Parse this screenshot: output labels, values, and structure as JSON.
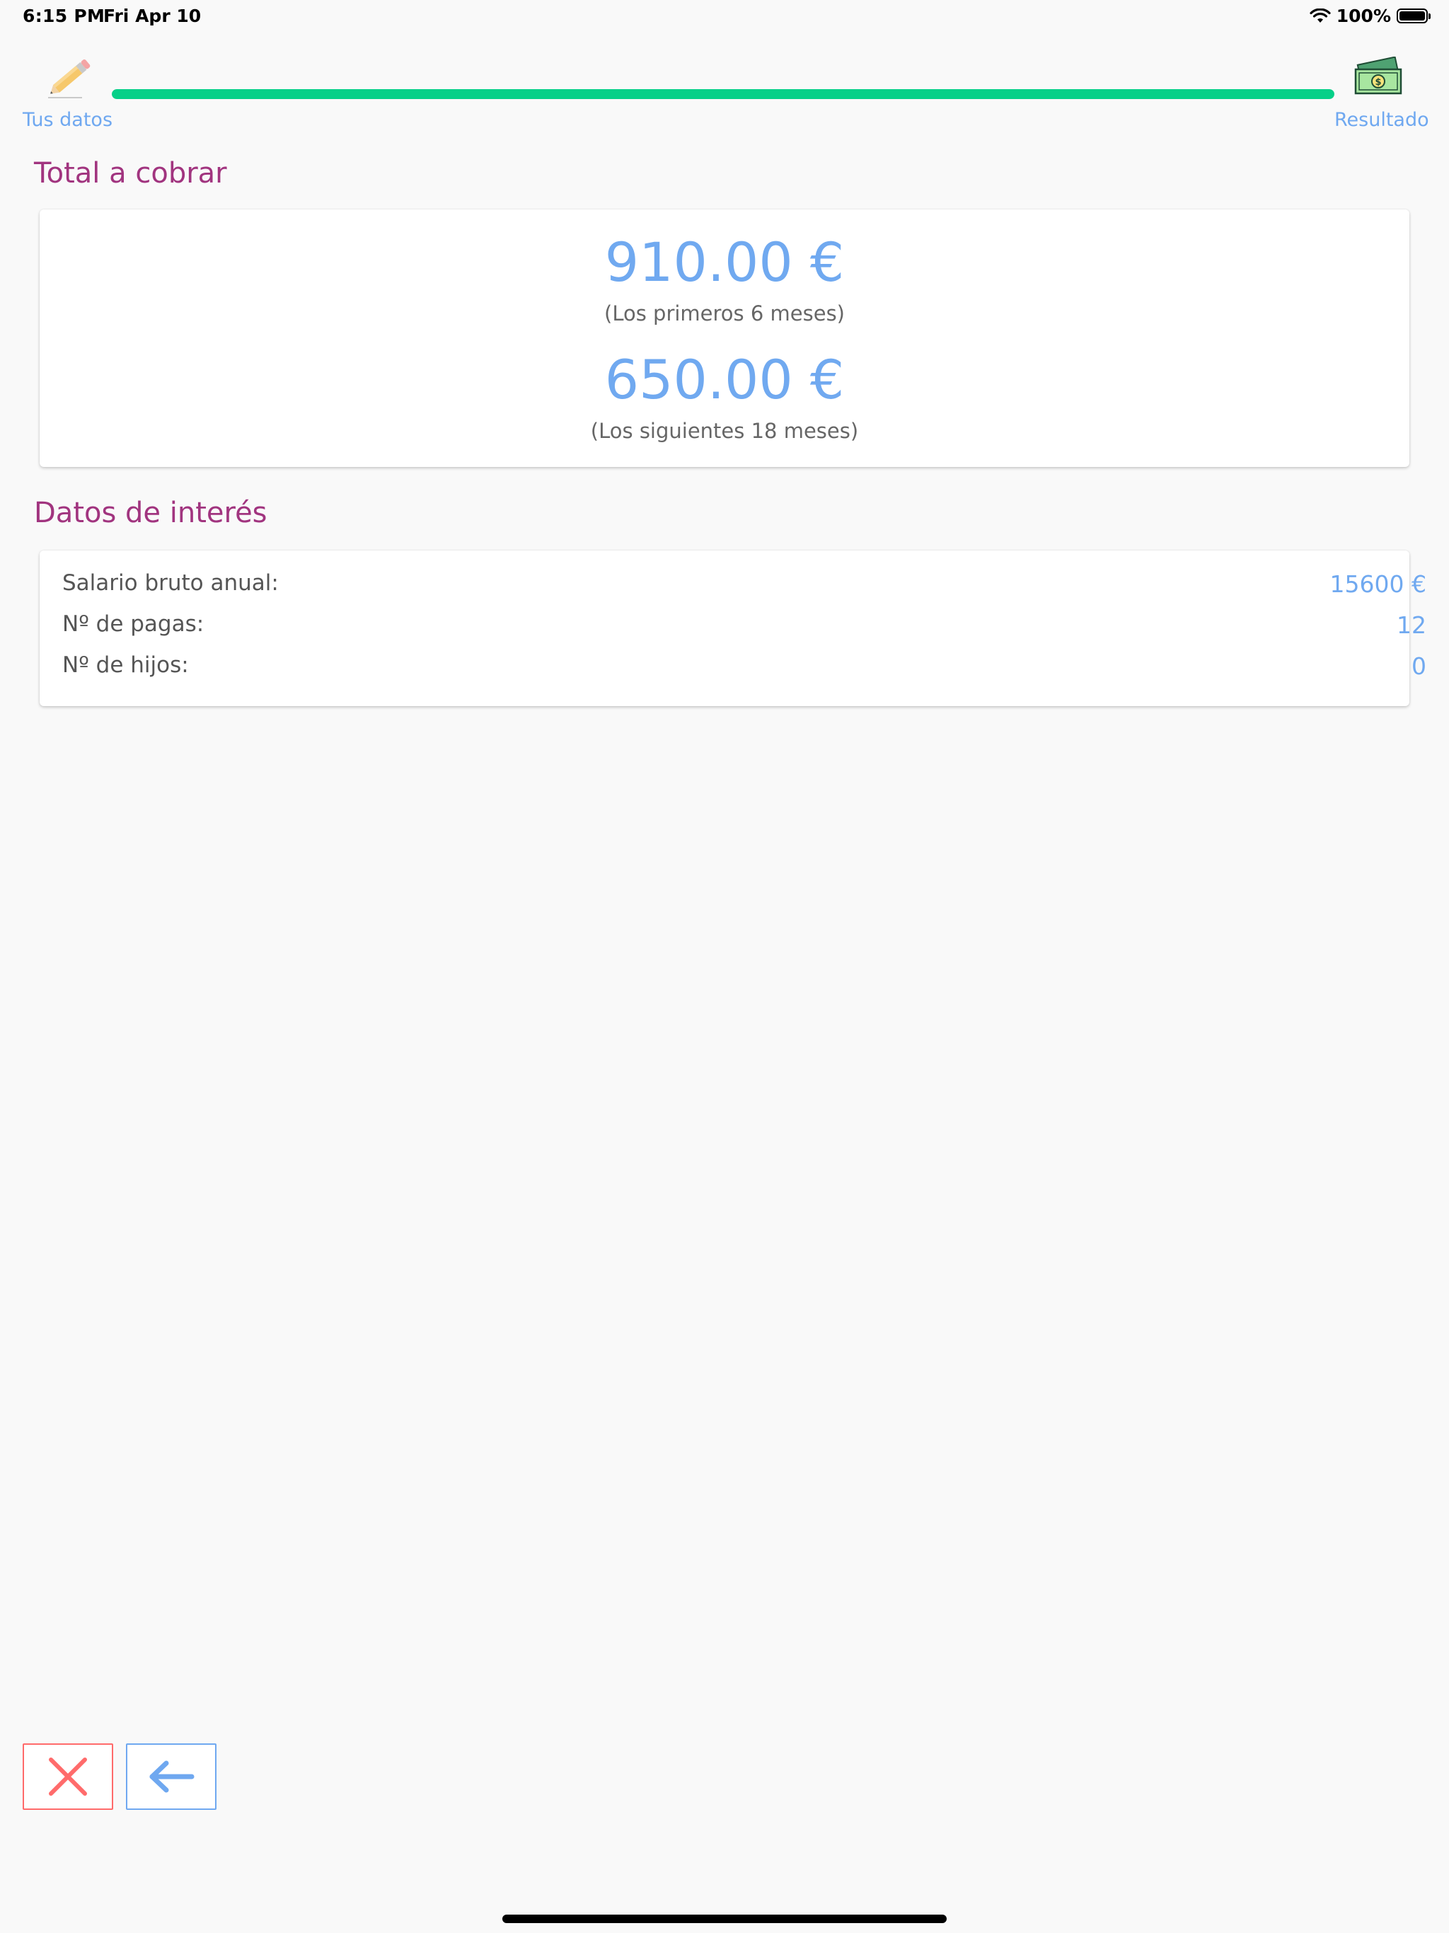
{
  "status_bar": {
    "time": "6:15 PM",
    "date": "Fri Apr 10",
    "battery": "100%"
  },
  "stepper": {
    "steps": [
      {
        "label": "Tus datos",
        "icon": "pencil-icon"
      },
      {
        "label": "Resultado",
        "icon": "money-icon"
      }
    ],
    "progress": 1.0,
    "progress_color": "#06d088"
  },
  "total": {
    "title": "Total a cobrar",
    "amounts": [
      {
        "value": "910.00 €",
        "note": "(Los primeros 6 meses)"
      },
      {
        "value": "650.00 €",
        "note": "(Los siguientes 18 meses)"
      }
    ]
  },
  "info": {
    "title": "Datos de interés",
    "rows": [
      {
        "label": "Salario bruto anual:",
        "value": "15600 €"
      },
      {
        "label": "Nº de pagas:",
        "value": "12"
      },
      {
        "label": "Nº de hijos:",
        "value": "0"
      }
    ]
  },
  "actions": {
    "cancel_icon": "close-icon",
    "back_icon": "arrow-left-icon"
  },
  "colors": {
    "accent_blue": "#70a9f0",
    "title_purple": "#a1347f",
    "cancel_red": "#ff6b6b",
    "progress_green": "#06d088"
  }
}
